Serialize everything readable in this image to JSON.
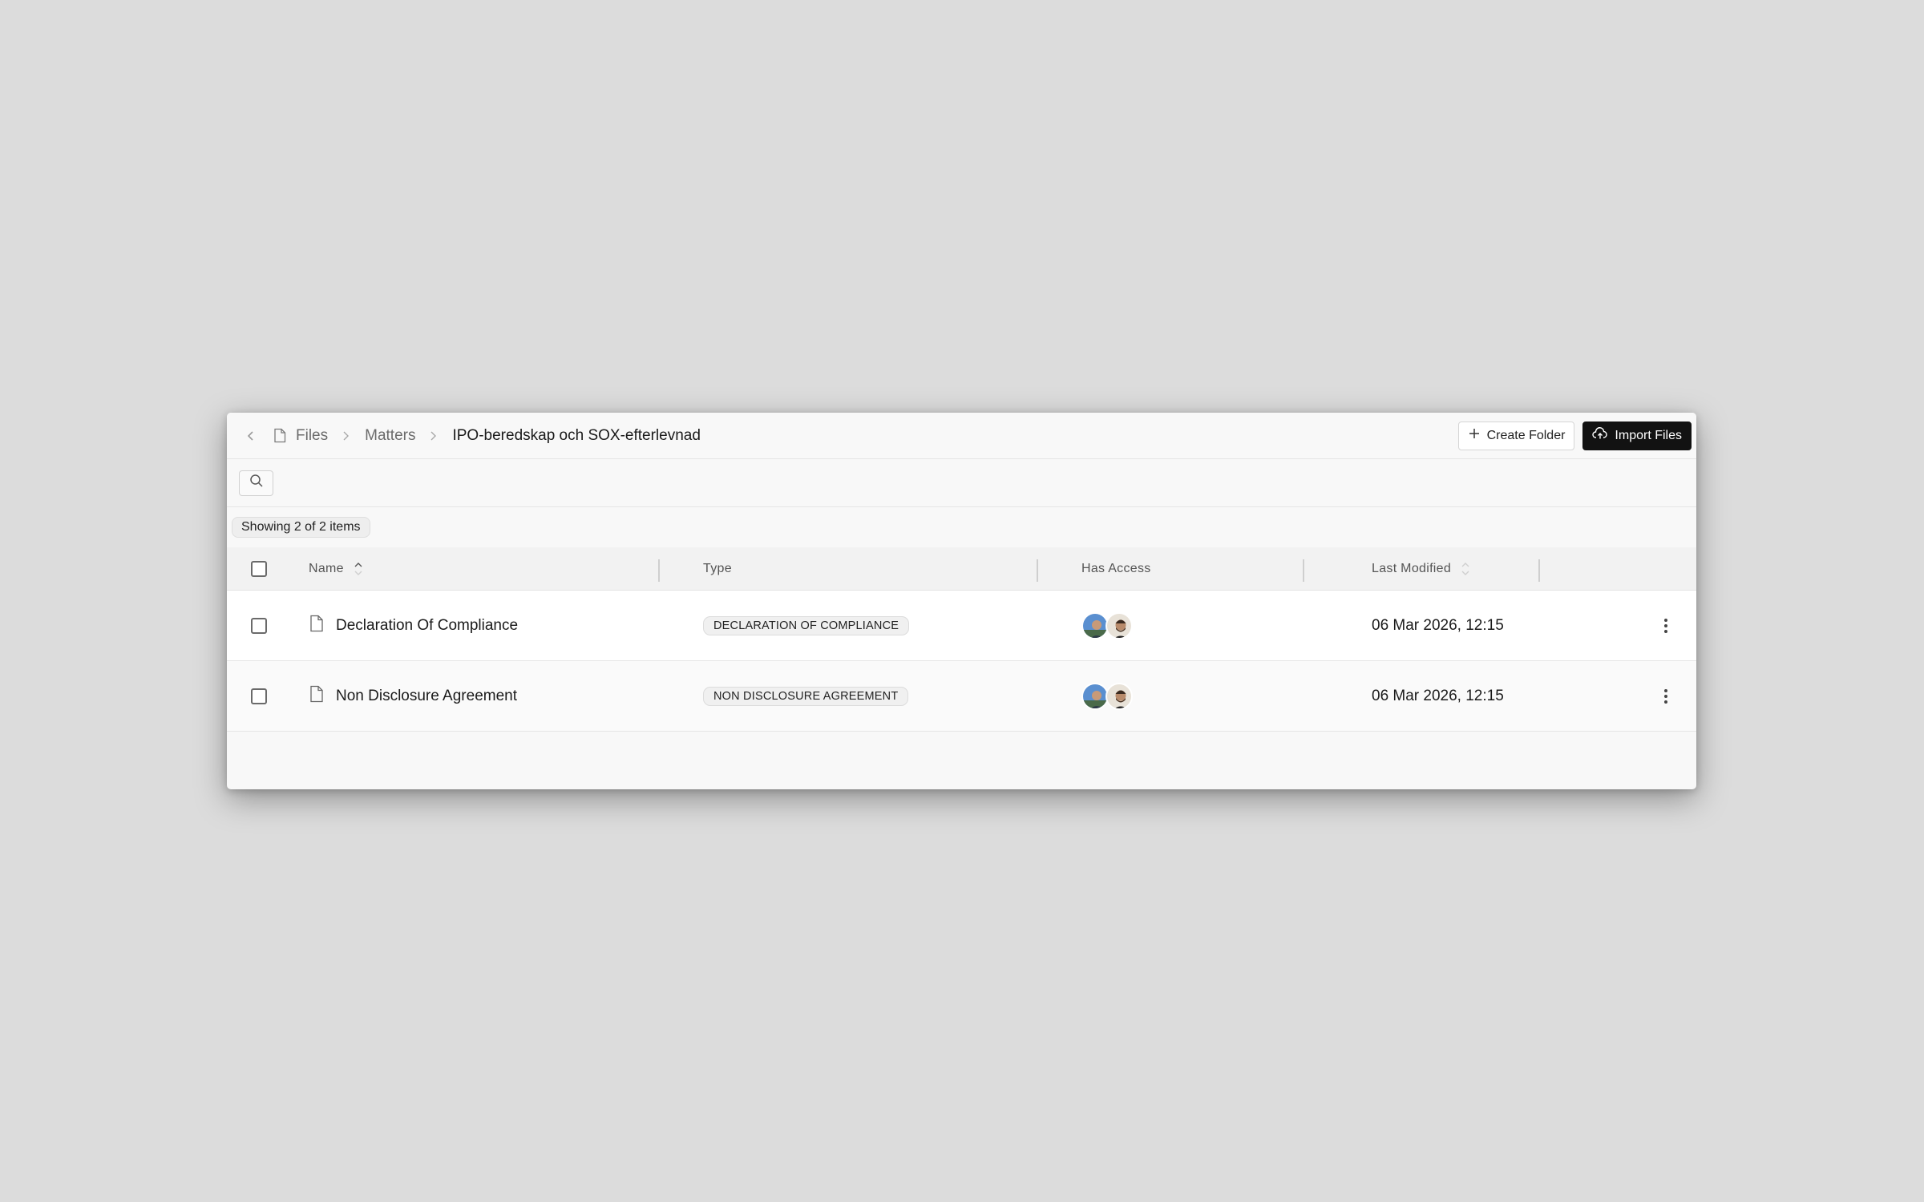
{
  "breadcrumb": {
    "items": [
      "Files",
      "Matters"
    ],
    "current": "IPO-beredskap och SOX-efterlevnad"
  },
  "header": {
    "create_folder_label": "Create Folder",
    "import_files_label": "Import Files"
  },
  "toolbar": {
    "search_icon": "search-icon"
  },
  "summary": {
    "count_text": "Showing 2 of 2 items"
  },
  "table": {
    "columns": {
      "name": "Name",
      "type": "Type",
      "access": "Has Access",
      "modified": "Last Modified"
    },
    "rows": [
      {
        "name": "Declaration Of Compliance",
        "type": "DECLARATION OF COMPLIANCE",
        "modified": "06 Mar 2026, 12:15"
      },
      {
        "name": "Non Disclosure Agreement",
        "type": "NON DISCLOSURE AGREEMENT",
        "modified": "06 Mar 2026, 12:15"
      }
    ]
  },
  "colors": {
    "accent_dark": "#121212",
    "background": "#dcdcdc"
  }
}
